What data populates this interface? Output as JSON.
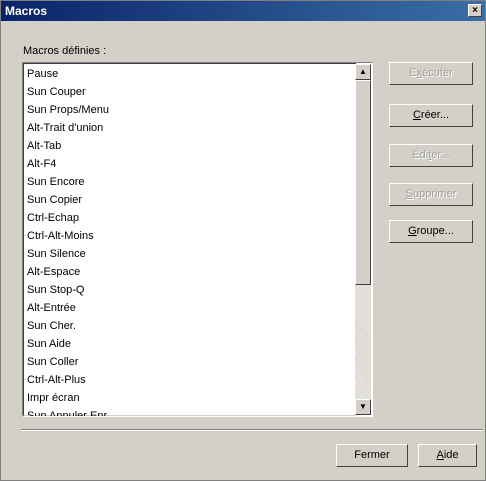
{
  "window": {
    "title": "Macros",
    "close_glyph": "×"
  },
  "list_label": "Macros définies :",
  "macros": [
    "Pause",
    "Sun Couper",
    "Sun Props/Menu",
    "Alt-Trait d'union",
    "Alt-Tab",
    "Alt-F4",
    "Sun Encore",
    "Sun Copier",
    "Ctrl-Echap",
    "Ctrl-Alt-Moins",
    "Sun Silence",
    "Alt-Espace",
    "Sun Stop-Q",
    "Alt-Entrée",
    "Sun Cher.",
    "Sun Aide",
    "Sun Coller",
    "Ctrl-Alt-Plus",
    "Impr écran",
    "Sun Annuler Enr."
  ],
  "scrollbar": {
    "up": "▲",
    "down": "▼"
  },
  "buttons": {
    "execute": {
      "pre": "E",
      "key": "x",
      "post": "écuter",
      "enabled": false
    },
    "create": {
      "pre": "",
      "key": "C",
      "post": "réer...",
      "enabled": true
    },
    "edit": {
      "pre": "Édi",
      "key": "t",
      "post": "er...",
      "enabled": false
    },
    "delete": {
      "pre": "",
      "key": "S",
      "post": "upprimer",
      "enabled": false
    },
    "group": {
      "pre": "",
      "key": "G",
      "post": "roupe...",
      "enabled": true
    },
    "close": {
      "label": "Fermer"
    },
    "help": {
      "pre": "",
      "key": "A",
      "post": "ide"
    }
  }
}
